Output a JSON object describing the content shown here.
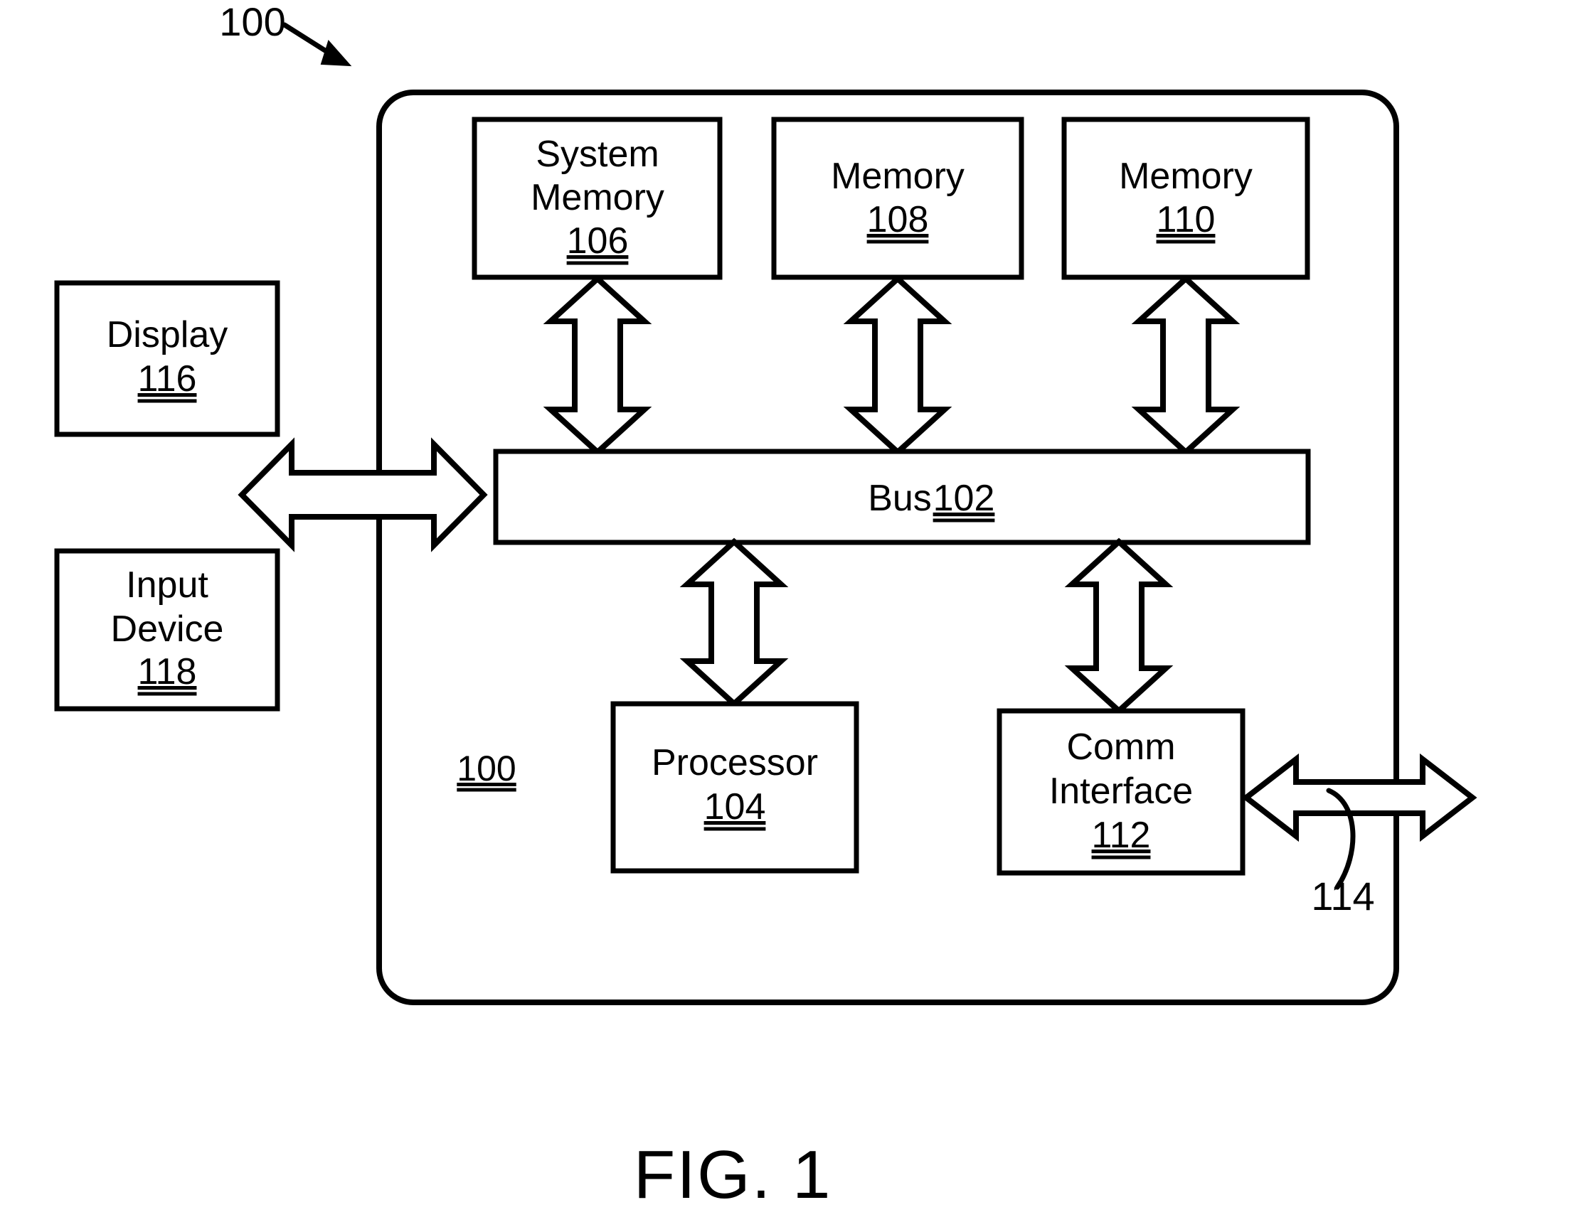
{
  "figure": {
    "caption": "FIG. 1",
    "top_callout": "100",
    "system_ref": "100",
    "link_callout": "114"
  },
  "container": {
    "name": "computing-device",
    "ref": "100"
  },
  "blocks": {
    "system_memory": {
      "line1": "System",
      "line2": "Memory",
      "ref": "106"
    },
    "memory_108": {
      "line1": "Memory",
      "ref": "108"
    },
    "memory_110": {
      "line1": "Memory",
      "ref": "110"
    },
    "bus": {
      "label": "Bus",
      "ref": "102"
    },
    "processor": {
      "line1": "Processor",
      "ref": "104"
    },
    "comm_interface": {
      "line1": "Comm",
      "line2": "Interface",
      "ref": "112"
    },
    "display": {
      "line1": "Display",
      "ref": "116"
    },
    "input_device": {
      "line1": "Input",
      "line2": "Device",
      "ref": "118"
    }
  },
  "connectors": {
    "system_memory_to_bus": "double-arrow-vertical",
    "memory_108_to_bus": "double-arrow-vertical",
    "memory_110_to_bus": "double-arrow-vertical",
    "bus_to_processor": "double-arrow-vertical",
    "bus_to_comm_interface": "double-arrow-vertical",
    "io_to_device": "double-arrow-horizontal",
    "comm_interface_external": "double-arrow-horizontal"
  },
  "colors": {
    "stroke": "#000000",
    "fill": "#ffffff",
    "background": "#ffffff"
  }
}
